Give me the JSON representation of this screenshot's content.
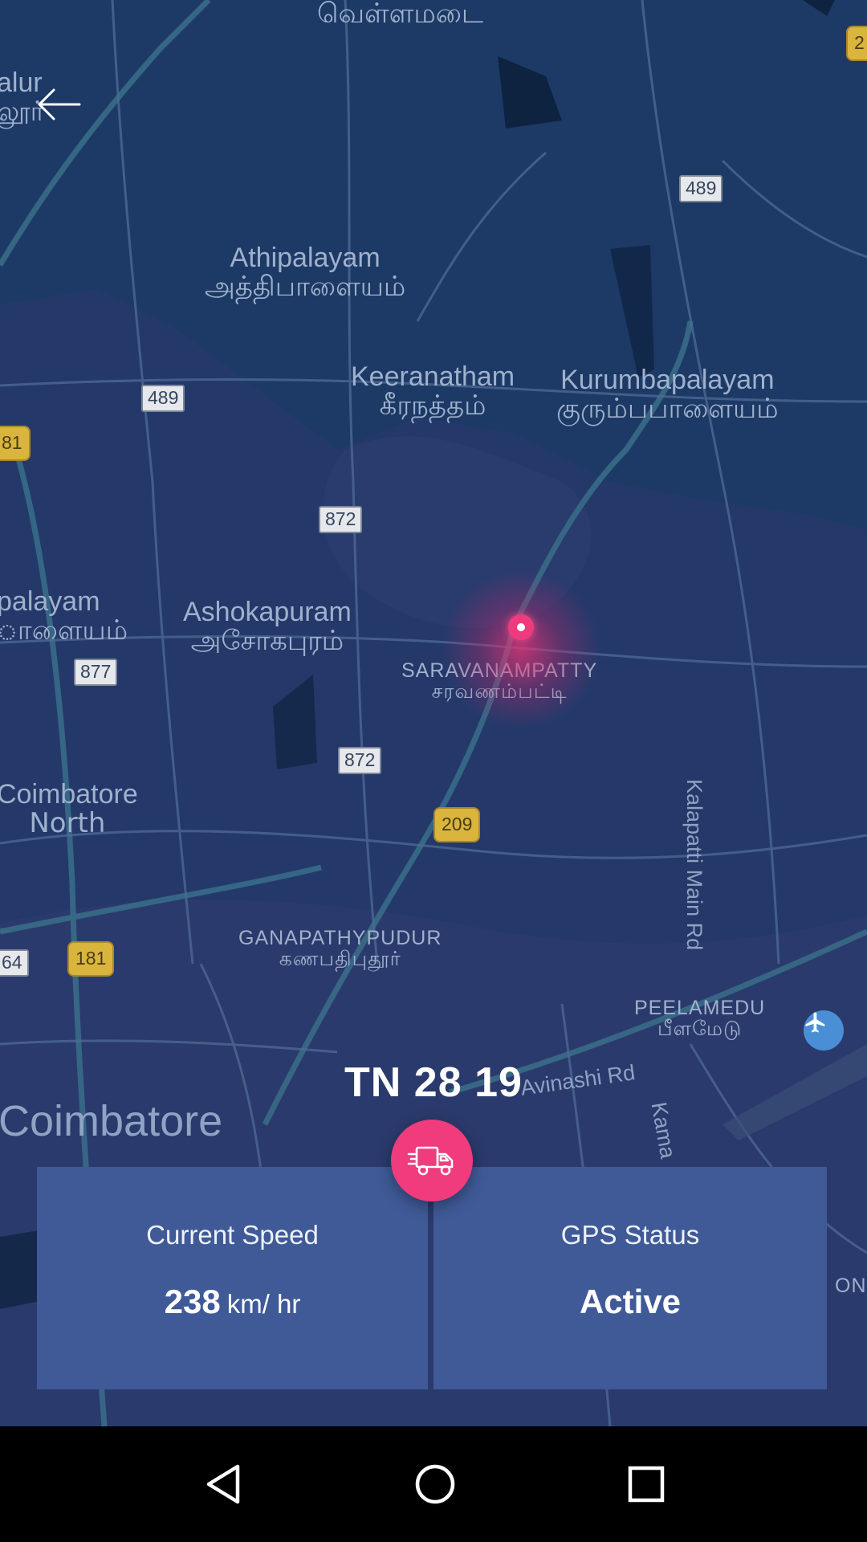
{
  "map": {
    "places": [
      {
        "en": "",
        "ta": "வெள்ளமடை"
      },
      {
        "en": "alur",
        "ta": "லூர்"
      },
      {
        "en": "Athipalayam",
        "ta": "அத்திபாளையம்"
      },
      {
        "en": "Keeranatham",
        "ta": "கீரநத்தம்"
      },
      {
        "en": "Kurumbapalayam",
        "ta": "குரும்பபாளையம்"
      },
      {
        "en": "palayam",
        "ta": "ாளையம்"
      },
      {
        "en": "Ashokapuram",
        "ta": "அசோகபுரம்"
      },
      {
        "en": "SARAVANAMPATTY",
        "ta": "சரவணம்பட்டி"
      },
      {
        "en": "Coimbatore",
        "ta": "North"
      },
      {
        "en": "GANAPATHYPUDUR",
        "ta": "கணபதிபுதூர்"
      },
      {
        "en": "PEELAMEDU",
        "ta": "பீளமேடு"
      },
      {
        "en": "Coimbatore",
        "ta": ""
      },
      {
        "en": "ON",
        "ta": ""
      }
    ],
    "road_signs": [
      "489",
      "489",
      "872",
      "877",
      "872",
      "209",
      "181",
      "81",
      "181",
      "64",
      "2"
    ],
    "road_labels": [
      "Kalapatti Main Rd",
      "Avinashi Rd",
      "Kama"
    ],
    "icons": {
      "back": "arrow-left-icon",
      "airport": "airplane-icon",
      "vehicle": "truck-icon"
    }
  },
  "vehicle": {
    "number": "TN 28 19"
  },
  "speed": {
    "title": "Current Speed",
    "value": "238",
    "unit": "km/ hr"
  },
  "gps": {
    "title": "GPS Status",
    "value": "Active"
  },
  "nav": {
    "icons": [
      "back-triangle-icon",
      "home-circle-icon",
      "recents-square-icon"
    ]
  },
  "colors": {
    "map_bg": "#1d3a66",
    "panel": "#3f5a97",
    "accent": "#f03b7d"
  }
}
